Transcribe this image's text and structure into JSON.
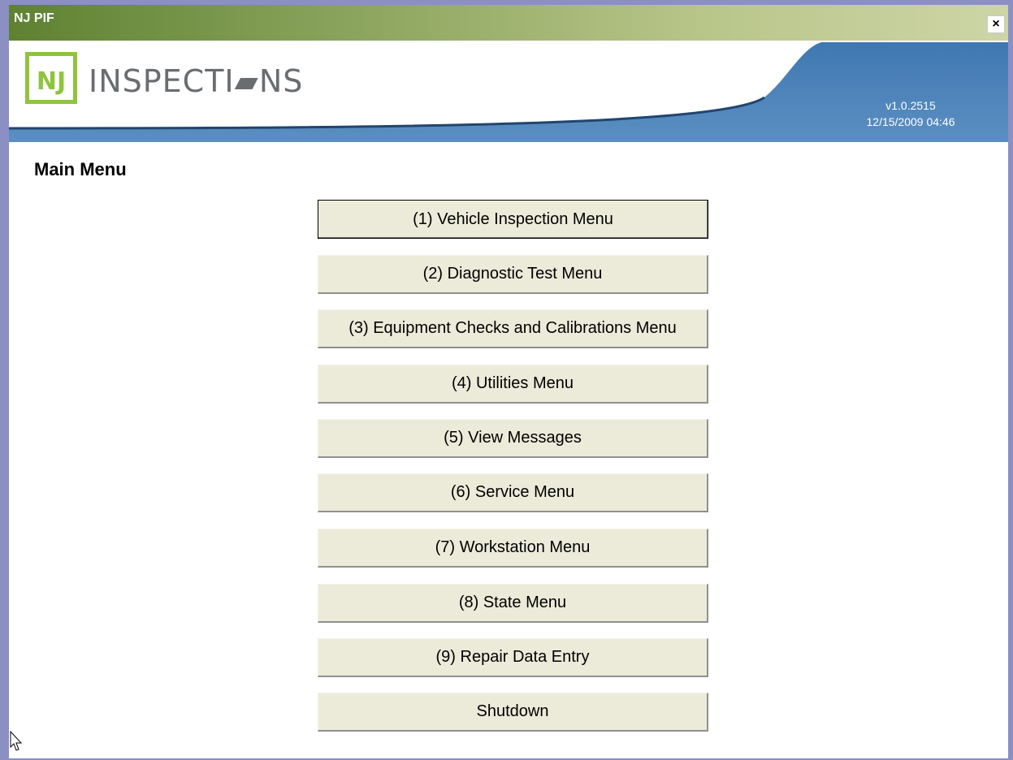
{
  "window": {
    "title": "NJ PIF",
    "close_glyph": "×"
  },
  "header": {
    "logo_nj": "NJ",
    "logo_text": "INSPECTI▰NS",
    "version": "v1.0.2515",
    "datetime": "12/15/2009 04:46",
    "accent_green": "#8fc43e",
    "accent_blue": "#4a7fb5"
  },
  "main": {
    "title": "Main Menu",
    "buttons": [
      {
        "label": "(1) Vehicle Inspection Menu"
      },
      {
        "label": "(2) Diagnostic Test Menu"
      },
      {
        "label": "(3) Equipment Checks and Calibrations Menu"
      },
      {
        "label": "(4) Utilities Menu"
      },
      {
        "label": "(5) View Messages"
      },
      {
        "label": "(6) Service Menu"
      },
      {
        "label": "(7) Workstation Menu"
      },
      {
        "label": "(8) State Menu"
      },
      {
        "label": "(9) Repair Data Entry"
      },
      {
        "label": "Shutdown"
      }
    ]
  }
}
